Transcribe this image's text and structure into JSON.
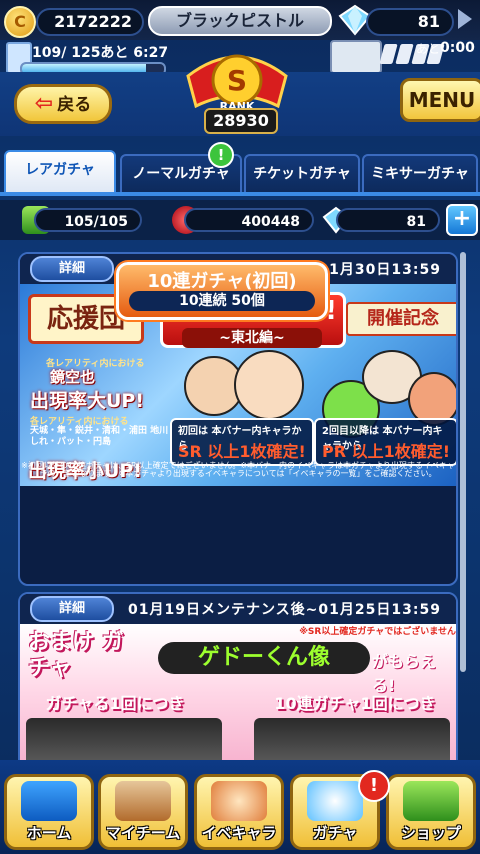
{
  "status": {
    "money": "2172222",
    "player_name": "ブラックピストル",
    "gems": "81",
    "stamina_text": "109/ 125あと  6:27",
    "stamina_ratio": 0.872,
    "ticket_ato": "あと",
    "ticket_time": "0:00"
  },
  "header": {
    "back_label": "戻る",
    "rank_letter": "S",
    "rank_word": "RANK",
    "rank_score": "28930",
    "menu_label": "MENU"
  },
  "tabs": [
    {
      "label": "レアガチャ",
      "active": true
    },
    {
      "label": "ノーマルガチャ",
      "active": false
    },
    {
      "label": "チケットガチャ",
      "active": false
    },
    {
      "label": "ミキサーガチャ",
      "active": false
    }
  ],
  "tab_notification": "!",
  "resources": {
    "green": "105/105",
    "red": "400448",
    "gem": "81",
    "plus": "+"
  },
  "banners": [
    {
      "detail_label": "詳細",
      "period": "01月19日メンテナンス後~01月30日13:59",
      "ouen": "応援団",
      "title": "ヒキョリくん!",
      "subtitle": "~東北編~",
      "kinen": "開催記念",
      "small1": "各レアリティ内における",
      "name1": "鏡空也",
      "up1": "出現率大UP!",
      "small2": "各レアリティ内における",
      "names2": "天城・隼・鋭井・清和・浦田 地川しれ・パット・円島",
      "up2": "出現率小UP!",
      "sr_box": "SR 以上1枚確定!",
      "sr_note": "初回は 本バナー内キャラから",
      "pr_box": "PR 以上1枚確定!",
      "pr_note": "2回目以降は 本バナー内キャラから",
      "note": "※初回以外の10連ガチャは、SR以上確定ではございません。※本バナー内のイベキャラは本ガチャより出現するイベキャラの一部となります。※本ガチャより出現するイベキャラについては「イベキャラの一覧」をご確認ください。",
      "button_top": "10連ガチャ(初回)",
      "button_bottom": "10連続 50個"
    },
    {
      "detail_label": "詳細",
      "period": "01月19日メンテナンス後~01月25日13:59",
      "omake": "おまけ ガチャ",
      "title": "ゲドーくん像",
      "moraeru": "がもらえる!",
      "note": "※SR以上確定ガチャではございません",
      "label_left": "ガチャる1回につき",
      "label_right": "10連ガチャ1回につき"
    }
  ],
  "nav": [
    {
      "label": "ホーム"
    },
    {
      "label": "マイチーム"
    },
    {
      "label": "イベキャラ"
    },
    {
      "label": "ガチャ"
    },
    {
      "label": "ショップ"
    }
  ],
  "nav_badge": "!"
}
